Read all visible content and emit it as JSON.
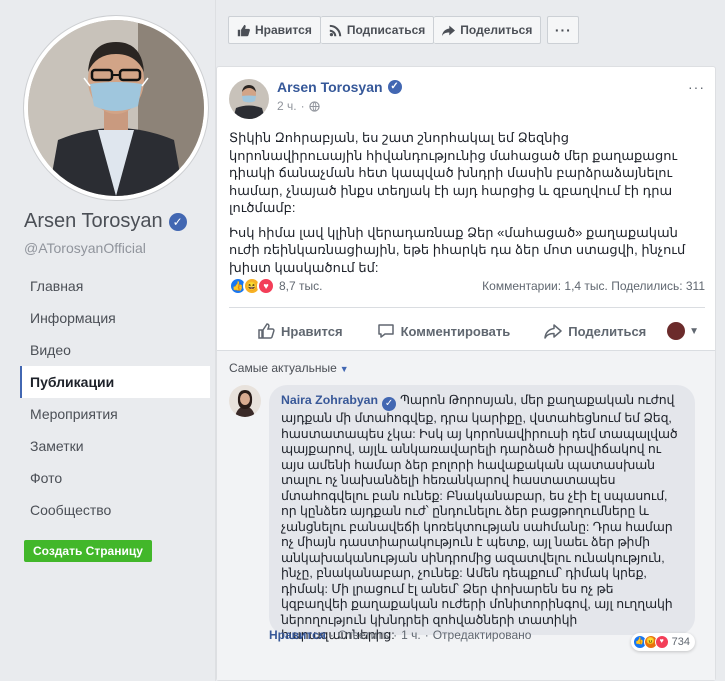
{
  "profile": {
    "name": "Arsen Torosyan",
    "handle": "@ATorosyanOfficial"
  },
  "nav": {
    "items": [
      {
        "label": "Главная"
      },
      {
        "label": "Информация"
      },
      {
        "label": "Видео"
      },
      {
        "label": "Публикации"
      },
      {
        "label": "Мероприятия"
      },
      {
        "label": "Заметки"
      },
      {
        "label": "Фото"
      },
      {
        "label": "Сообщество"
      }
    ],
    "active_index": 3,
    "create_page": "Создать Страницу"
  },
  "top_bar": {
    "like": "Нравится",
    "subscribe": "Подписаться",
    "share": "Поделиться",
    "more": "···"
  },
  "post": {
    "author": "Arsen Torosyan",
    "time": "2 ч.",
    "more": "···",
    "paragraph1": "Տիկին Զոհրաբյան, ես շատ շնորհակալ եմ Ձեզնից կորոնավիրուսային հիվանդությունից մահացած մեր քաղաքացու դիակի ճանաչման հետ կապված խնդրի մասին բարձրաձայնելու համար, չնայած ինքս տեղյակ էի այդ հարցից և զբաղվում էի դրա լուծմամբ:",
    "paragraph2": "Իսկ հիմա լավ կլինի վերադառնաք Ձեր «մահացած» քաղաքական ուժի ռեինկառնացիային, եթե իհարկե դա ձեր մոտ ստացվի, ինչում խիստ կասկածում եմ:",
    "reaction_count": "8,7 тыс.",
    "comments_shares": "Комментарии: 1,4 тыс.   Поделились: 311",
    "actions": {
      "like": "Нравится",
      "comment": "Комментировать",
      "share": "Поделиться"
    }
  },
  "comments": {
    "sort_label": "Самые актуальные",
    "items": [
      {
        "author": "Naira Zohrabyan",
        "text": "Պարոն Թորոսյան, մեր քաղաքական ուժով այդքան մի մտահոգվեք, դրա կարիքը, վստահեցնում եմ Ձեզ, հաստատապես չկա: Իսկ այ կորոնավիրուսի դեմ տապալված պայքարով, այլև անկառավարելի դարձած իրավիճակով ու այս ամենի համար ձեր բոլորի հավաքական պատասխան տալու ոչ նախանձելի հեռանկարով հաստատապես մտահոգվելու բան ունեք: Բնականաբար, ես չէի էլ սպասում, որ կընձեռ այդքան ուժ՝ ընդունելու ձեր բացթողումները և չանցնելու բանավեճի կոռեկտության սահմանը: Դրա համար ոչ միայն դաստիարակություն է պետք, այլ նաեւ ձեր թիմի անկախականության սինդրոմից ազատվելու ունակություն, ինչը, բնականաբար, չունեք: Ամեն դեպքում՝ դիմակ կրեք, դիմակ: Մի լրացում էլ անեմ՝ Ձեր փոխարեն ես ոչ թե կզբաղվեի քաղաքական ուժերի մոնիտորինգով, այլ ուղղակի ներողություն կխնդրեի զոհվածների տատիկի հարազատներից:",
        "reaction_count": "734",
        "like": "Нравится",
        "reply": "Ответить",
        "time": "1 ч.",
        "edited": "Отредактировано"
      }
    ]
  },
  "colors": {
    "link_blue": "#365899",
    "green_button": "#42b72a",
    "page_bg": "#e9ebee"
  }
}
